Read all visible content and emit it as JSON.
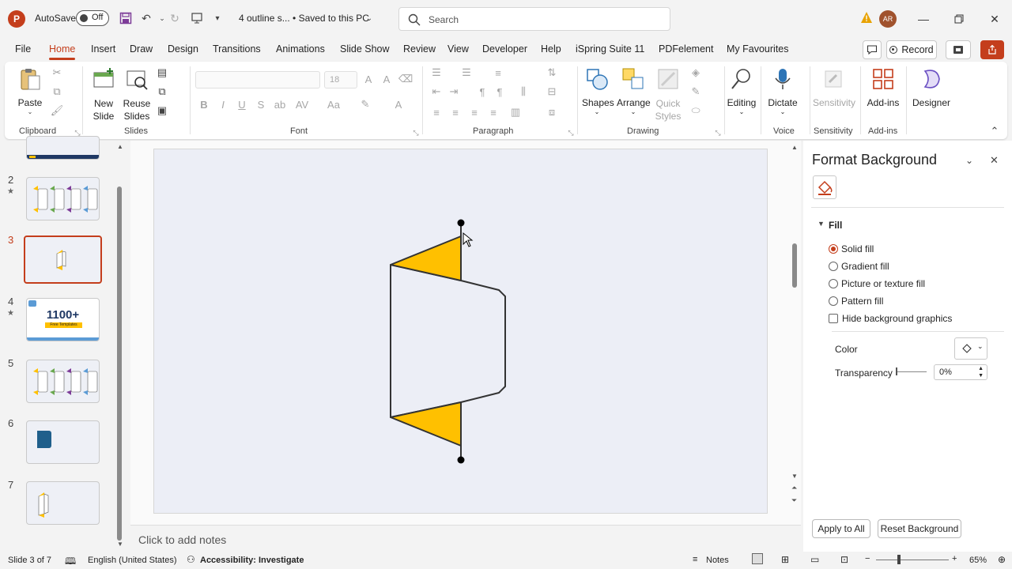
{
  "titlebar": {
    "app_letter": "P",
    "autosave_label": "AutoSave",
    "autosave_state": "Off",
    "doc_title": "4 outline s...  •  Saved to this PC",
    "search_placeholder": "Search",
    "avatar_initials": "AR"
  },
  "menu": {
    "tabs": [
      "File",
      "Home",
      "Insert",
      "Draw",
      "Design",
      "Transitions",
      "Animations",
      "Slide Show",
      "Review",
      "View",
      "Developer",
      "Help",
      "iSpring Suite 11",
      "PDFelement",
      "My Favourites"
    ],
    "active": "Home",
    "record_label": "Record"
  },
  "ribbon": {
    "clipboard": {
      "paste": "Paste",
      "label": "Clipboard"
    },
    "slides": {
      "new_slide": "New Slide",
      "reuse_slides": "Reuse Slides",
      "label": "Slides"
    },
    "font": {
      "size": "18",
      "label": "Font"
    },
    "paragraph": {
      "label": "Paragraph"
    },
    "drawing": {
      "shapes": "Shapes",
      "arrange": "Arrange",
      "quick_styles": "Quick Styles",
      "label": "Drawing"
    },
    "editing": {
      "label_btn": "Editing"
    },
    "voice": {
      "dictate": "Dictate",
      "label": "Voice"
    },
    "sensitivity": {
      "btn": "Sensitivity",
      "label": "Sensitivity"
    },
    "addins": {
      "btn": "Add-ins",
      "label": "Add-ins"
    },
    "designer": {
      "btn": "Designer"
    }
  },
  "thumbnails": {
    "numbers": [
      "2",
      "3",
      "4",
      "5",
      "6",
      "7"
    ],
    "active": "3",
    "slide4_text": "1100+",
    "slide4_sub": "Free Templates"
  },
  "notes_placeholder": "Click to add notes",
  "format_pane": {
    "title": "Format Background",
    "section": "Fill",
    "options": [
      "Solid fill",
      "Gradient fill",
      "Picture or texture fill",
      "Pattern fill"
    ],
    "selected": "Solid fill",
    "hide_bg": "Hide background graphics",
    "color_label": "Color",
    "transparency_label": "Transparency",
    "transparency_value": "0%",
    "apply_all": "Apply to All",
    "reset": "Reset Background"
  },
  "status": {
    "slide_info": "Slide 3 of 7",
    "language": "English (United States)",
    "accessibility": "Accessibility: Investigate",
    "notes": "Notes",
    "zoom": "65%"
  },
  "colors": {
    "accent": "#c43e1c",
    "shape_fill": "#ffc000"
  }
}
